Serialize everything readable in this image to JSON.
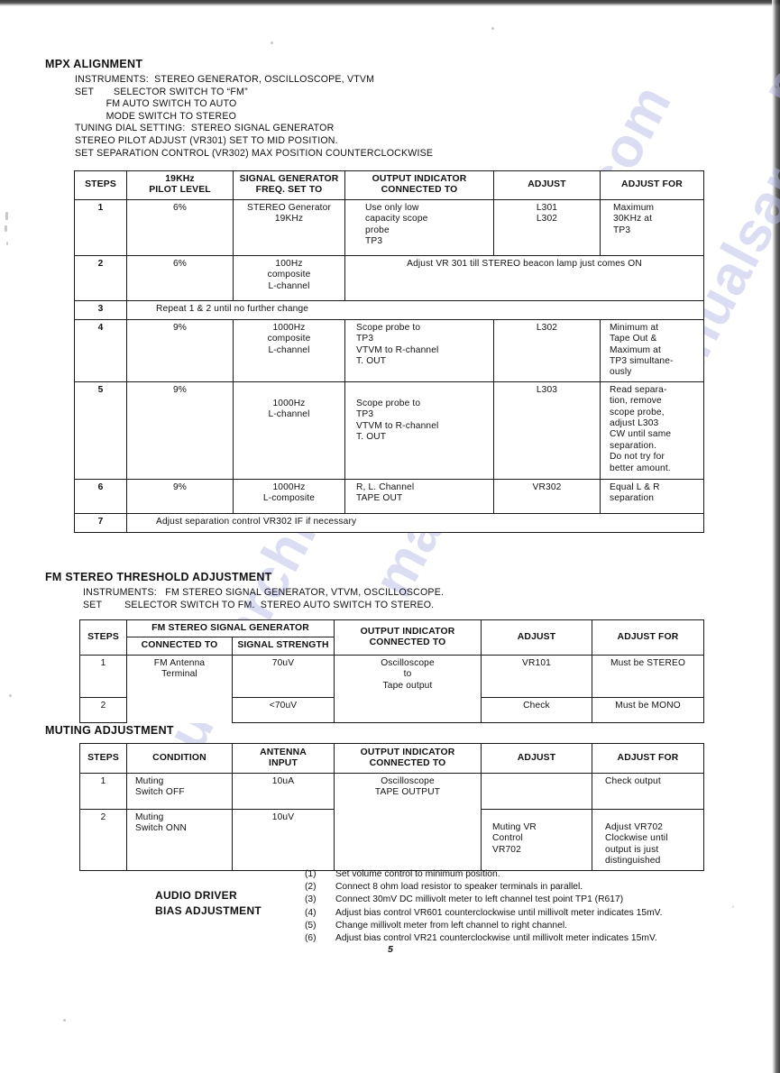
{
  "page": {
    "number": "5"
  },
  "watermark": {
    "text": "manualsarchive.com"
  },
  "mpx": {
    "title": "MPX ALIGNMENT",
    "preamble": "INSTRUMENTS:  STEREO GENERATOR, OSCILLOSCOPE, VTVM\nSET       SELECTOR SWITCH TO “FM”\n           FM AUTO SWITCH TO AUTO\n           MODE SWITCH TO STEREO\nTUNING DIAL SETTING:  STEREO SIGNAL GENERATOR\nSTEREO PILOT ADJUST (VR301) SET TO MID POSITION.\nSET SEPARATION CONTROL (VR302) MAX POSITION COUNTERCLOCKWISE",
    "headers": {
      "steps": "STEPS",
      "pilot": "19KHz\nPILOT LEVEL",
      "siggen": "SIGNAL GENERATOR\nFREQ. SET TO",
      "output": "OUTPUT INDICATOR\nCONNECTED TO",
      "adjust": "ADJUST",
      "adjust_for": "ADJUST FOR"
    },
    "rows": [
      {
        "step": "1",
        "pilot": "6%",
        "siggen": "STEREO Generator\n19KHz",
        "output": "Use only low\ncapacity scope\nprobe\n      TP3",
        "adjust": "L301\nL302",
        "adjust_for": "Maximum\n30KHz at\nTP3"
      },
      {
        "step": "2",
        "pilot": "6%",
        "siggen": "100Hz\ncomposite\nL-channel",
        "span": "Adjust VR 301 till STEREO beacon lamp just comes ON"
      },
      {
        "step": "3",
        "full": "Repeat 1 & 2 until no further change"
      },
      {
        "step": "4",
        "pilot": "9%",
        "siggen": "1000Hz\ncomposite\nL-channel",
        "output": "Scope probe to\nTP3\nVTVM to R-channel\nT. OUT",
        "adjust": "L302",
        "adjust_for": "Minimum at\nTape Out &\nMaximum at\nTP3 simultane-\nously"
      },
      {
        "step": "5",
        "pilot": "9%",
        "siggen": "1000Hz\nL-channel",
        "output": "Scope probe to\nTP3\nVTVM to R-channel\nT. OUT",
        "adjust": "L303",
        "adjust_for": "Read separa-\ntion, remove\nscope probe,\nadjust L303\nCW until same\nseparation.\nDo not try for\nbetter amount."
      },
      {
        "step": "6",
        "pilot": "9%",
        "siggen": "1000Hz\nL-composite",
        "output": "R, L. Channel\nTAPE OUT",
        "adjust": "VR302",
        "adjust_for": "Equal L & R\nseparation"
      },
      {
        "step": "7",
        "full": "Adjust separation control VR302 IF if necessary"
      }
    ]
  },
  "fm_threshold": {
    "title": "FM STEREO THRESHOLD ADJUSTMENT",
    "preamble": "INSTRUMENTS:   FM STEREO SIGNAL GENERATOR, VTVM, OSCILLOSCOPE.\nSET        SELECTOR SWITCH TO FM.  STEREO AUTO SWITCH TO STEREO.",
    "headers": {
      "steps": "STEPS",
      "group": "FM STEREO SIGNAL GENERATOR",
      "connected_to": "CONNECTED TO",
      "signal_strength": "SIGNAL STRENGTH",
      "output": "OUTPUT INDICATOR\nCONNECTED TO",
      "adjust": "ADJUST",
      "adjust_for": "ADJUST FOR"
    },
    "rows": [
      {
        "step": "1",
        "connected_to": "FM Antenna\nTerminal",
        "signal_strength": "70uV",
        "output": "Oscilloscope\nto\nTape output",
        "adjust": "VR101",
        "adjust_for": "Must be STEREO"
      },
      {
        "step": "2",
        "connected_to": "",
        "signal_strength": "<70uV",
        "output": "",
        "adjust": "Check",
        "adjust_for": "Must be MONO"
      }
    ]
  },
  "muting": {
    "title": "MUTING ADJUSTMENT",
    "headers": {
      "steps": "STEPS",
      "condition": "CONDITION",
      "antenna": "ANTENNA\nINPUT",
      "output": "OUTPUT INDICATOR\nCONNECTED TO",
      "adjust": "ADJUST",
      "adjust_for": "ADJUST FOR"
    },
    "rows": [
      {
        "step": "1",
        "condition": "Muting\nSwitch OFF",
        "antenna": "10uA",
        "output": "Oscilloscope\nTAPE OUTPUT",
        "adjust": "",
        "adjust_for": "Check output"
      },
      {
        "step": "2",
        "condition": "Muting\nSwitch ONN",
        "antenna": "10uV",
        "adjust": "Muting VR\nControl\nVR702",
        "adjust_for": "Adjust VR702\nClockwise until\noutput is just\ndistinguished"
      }
    ]
  },
  "bias": {
    "label_line1": "AUDIO DRIVER",
    "label_line2": "BIAS ADJUSTMENT",
    "steps": [
      {
        "num": "(1)",
        "text": "Set volume control to minimum position."
      },
      {
        "num": "(2)",
        "text": "Connect 8 ohm load resistor to speaker terminals in parallel."
      },
      {
        "num": "(3)",
        "text": "Connect 30mV DC millivolt meter to left channel test point TP1 (R617)"
      },
      {
        "num": "(4)",
        "text": "Adjust bias control VR601 counterclockwise until millivolt meter indicates 15mV."
      },
      {
        "num": "(5)",
        "text": "Change millivolt meter from left channel to right channel."
      },
      {
        "num": "(6)",
        "text": "Adjust bias control VR21 counterclockwise until millivolt meter indicates 15mV."
      }
    ]
  }
}
